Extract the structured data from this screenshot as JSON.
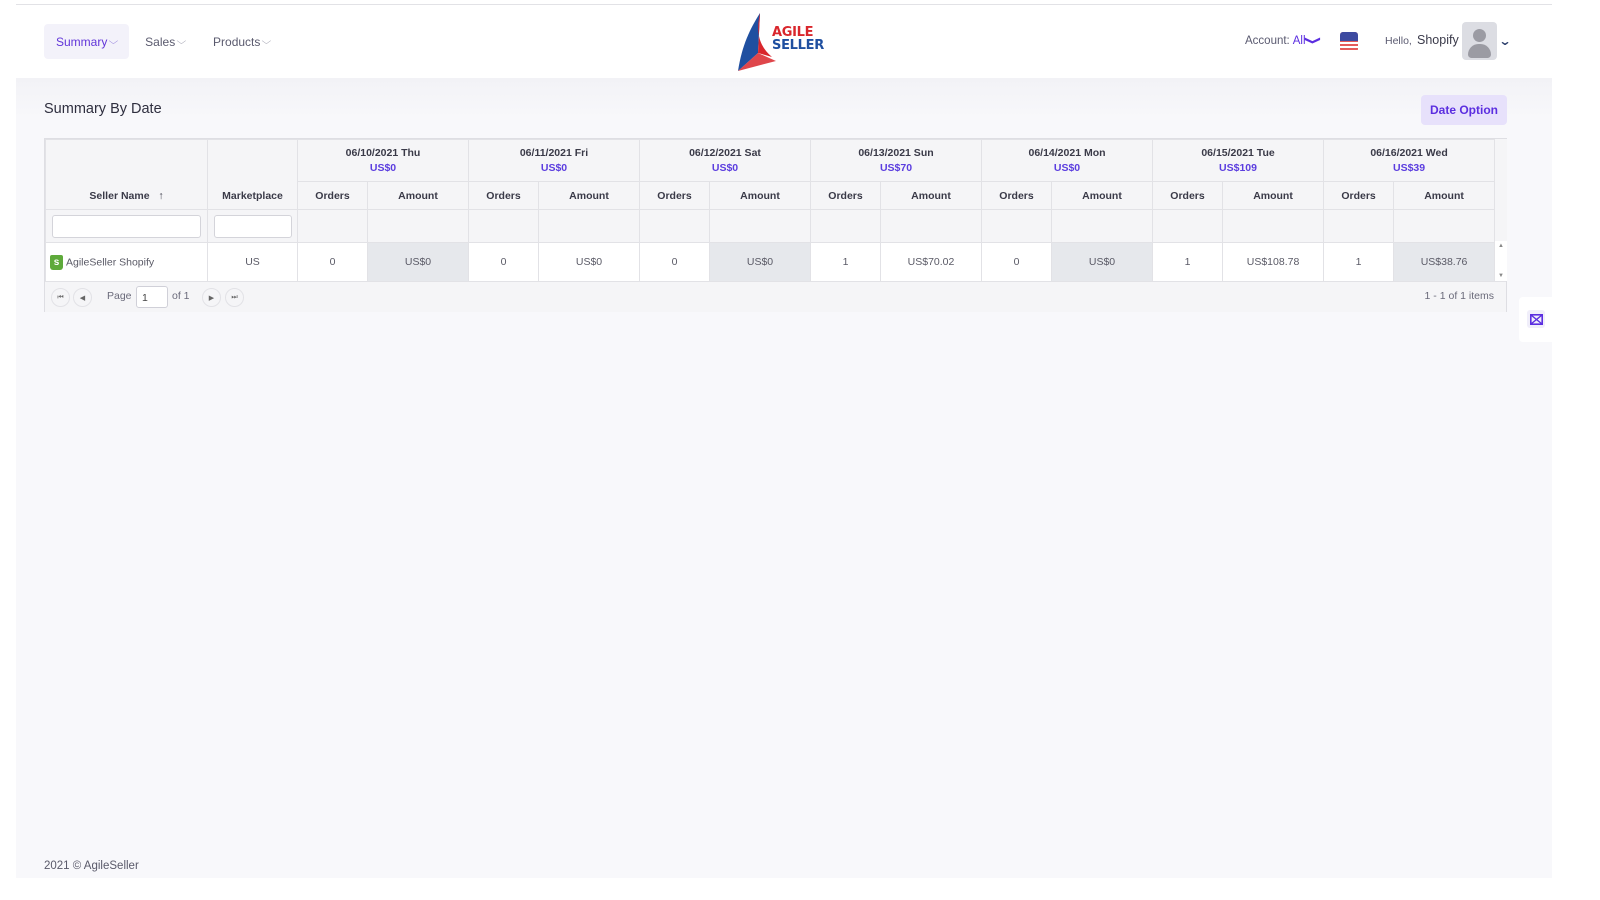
{
  "nav": {
    "items": [
      {
        "label": "Summary",
        "active": true
      },
      {
        "label": "Sales",
        "active": false
      },
      {
        "label": "Products",
        "active": false
      }
    ],
    "chevron": "⌵"
  },
  "logo": {
    "line1": "AGILE",
    "line2": "SELLER"
  },
  "account": {
    "label": "Account:",
    "value": "All",
    "chevron": "❯"
  },
  "user": {
    "greeting": "Hello,",
    "name": "Shopify"
  },
  "page": {
    "title": "Summary By Date",
    "date_option": "Date Option"
  },
  "table": {
    "col_seller": "Seller Name",
    "sort_icon": "↑",
    "col_marketplace": "Marketplace",
    "sub_orders": "Orders",
    "sub_amount": "Amount",
    "dates": [
      {
        "date": "06/10/2021 Thu",
        "total": "US$0"
      },
      {
        "date": "06/11/2021 Fri",
        "total": "US$0"
      },
      {
        "date": "06/12/2021 Sat",
        "total": "US$0"
      },
      {
        "date": "06/13/2021 Sun",
        "total": "US$70"
      },
      {
        "date": "06/14/2021 Mon",
        "total": "US$0"
      },
      {
        "date": "06/15/2021 Tue",
        "total": "US$109"
      },
      {
        "date": "06/16/2021 Wed",
        "total": "US$39"
      }
    ],
    "rows": [
      {
        "seller": "AgileSeller Shopify",
        "marketplace": "US",
        "cells": [
          {
            "orders": "0",
            "amount": "US$0"
          },
          {
            "orders": "0",
            "amount": "US$0"
          },
          {
            "orders": "0",
            "amount": "US$0"
          },
          {
            "orders": "1",
            "amount": "US$70.02"
          },
          {
            "orders": "0",
            "amount": "US$0"
          },
          {
            "orders": "1",
            "amount": "US$108.78"
          },
          {
            "orders": "1",
            "amount": "US$38.76"
          }
        ]
      }
    ]
  },
  "pager": {
    "page_label": "Page",
    "page_value": "1",
    "of_label": "of 1",
    "items_label": "1 - 1 of 1 items",
    "first": "⏮",
    "prev": "◀",
    "next": "▶",
    "last": "⏭"
  },
  "footer": {
    "text": "2021 © AgileSeller"
  }
}
